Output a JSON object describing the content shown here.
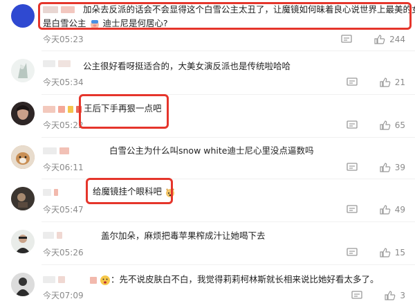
{
  "colors": {
    "accent_red": "#e5352b",
    "meta_gray": "#8a8a8a"
  },
  "comments": [
    {
      "text_line1": "加朵去反派的话会不会显得这个白雪公主太丑了，让魔镜如何昧着良心说世界上最美的女人",
      "text_line2a": "是白雪公主",
      "text_line2b": "迪士尼是何居心?",
      "time": "今天05:23",
      "likes": "244"
    },
    {
      "text": "公主很好看呀挺适合的，大美女演反派也是传统啦哈哈",
      "time": "今天05:34",
      "likes": "21"
    },
    {
      "text": "王后下手再狠一点吧",
      "time": "今天05:22",
      "likes": "65"
    },
    {
      "text": "白雪公主为什么叫snow white迪士尼心里没点逼数吗",
      "time": "今天06:11",
      "likes": "39"
    },
    {
      "text": "给魔镜挂个眼科吧",
      "time": "今天05:47",
      "likes": "49"
    },
    {
      "text": "盖尔加朵，麻烦把毒苹果榨成汁让她喝下去",
      "time": "今天05:26",
      "likes": "15"
    },
    {
      "text": "：先不说皮肤白不白，我觉得莉莉柯林斯就长相来说比她好看太多了。",
      "time": "今天07:09",
      "likes": "3"
    }
  ],
  "icons": {
    "reply": "comment-icon",
    "like": "thumbs-up-icon"
  }
}
